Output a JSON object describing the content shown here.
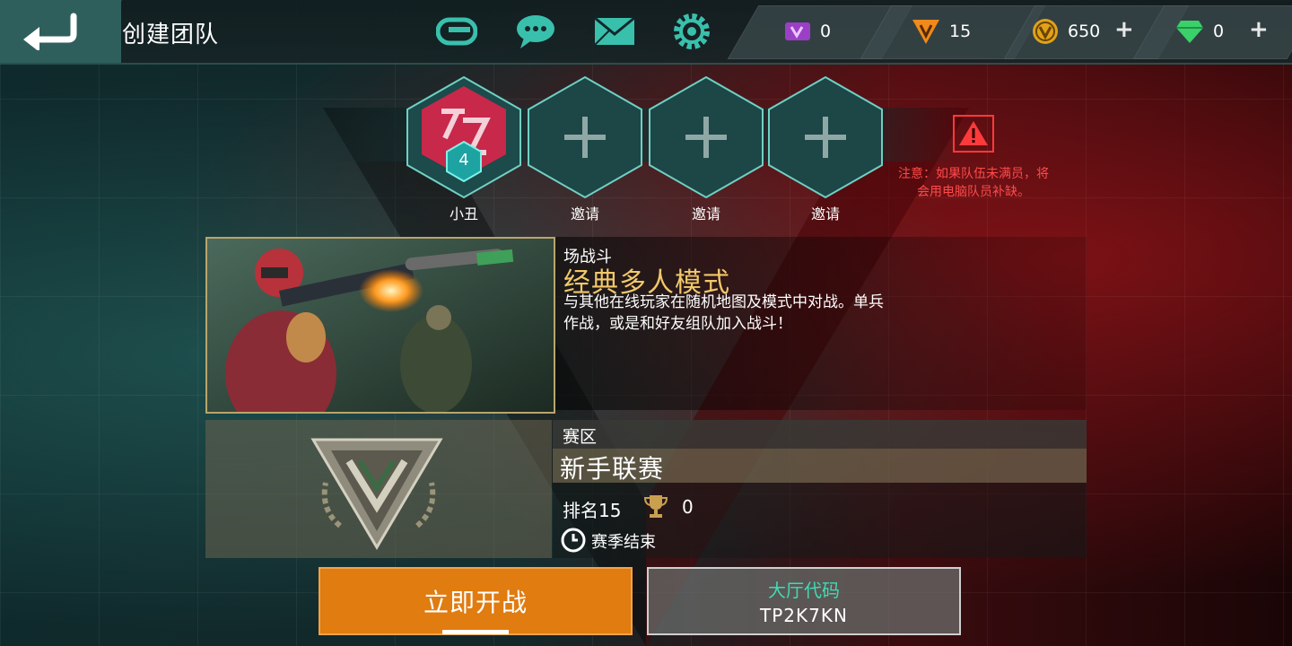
{
  "header": {
    "title": "创建团队"
  },
  "currencies": [
    {
      "name": "purple-token",
      "value": "0",
      "color": "#9b3fc6"
    },
    {
      "name": "orange-token",
      "value": "15",
      "color": "#f08a1a"
    },
    {
      "name": "gold-coin",
      "value": "650",
      "color": "#e0a21a"
    },
    {
      "name": "green-diamond",
      "value": "0",
      "color": "#3ad16a"
    }
  ],
  "plus_symbol": "+",
  "team": {
    "slots": [
      {
        "label": "小丑",
        "level": "4"
      },
      {
        "label": "邀请"
      },
      {
        "label": "邀请"
      },
      {
        "label": "邀请"
      }
    ],
    "warning": "注意：如果队伍未满员，将会用电脑队员补缺。"
  },
  "mode": {
    "subtitle": "场战斗",
    "title": "经典多人模式",
    "description": "与其他在线玩家在随机地图及模式中对战。单兵作战，或是和好友组队加入战斗！"
  },
  "league": {
    "label": "赛区",
    "name": "新手联赛",
    "rank": "排名15",
    "trophies": "0",
    "season": "赛季结束"
  },
  "buttons": {
    "play": "立即开战",
    "lobby_label": "大厅代码",
    "lobby_code": "TP2K7KN"
  },
  "colors": {
    "accent_teal": "#2f5f5c",
    "play_orange": "#e07c10",
    "warning_red": "#ff4a4a",
    "mode_gold": "#f2c86a"
  }
}
